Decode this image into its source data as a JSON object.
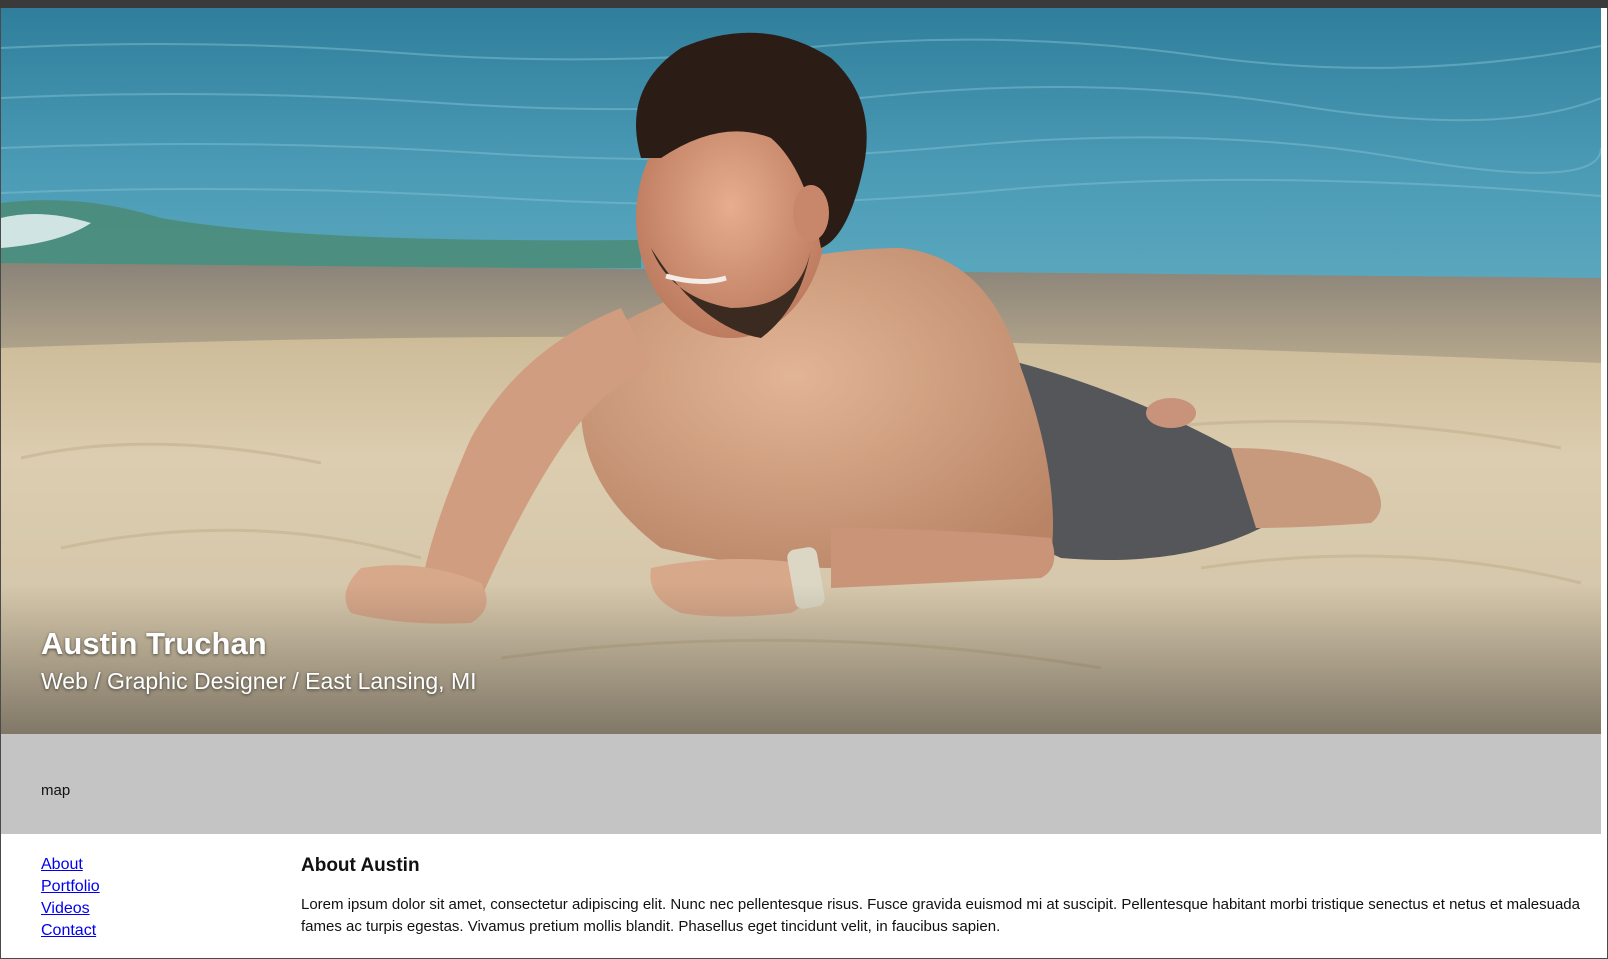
{
  "hero": {
    "name": "Austin Truchan",
    "tagline": "Web / Graphic Designer / East Lansing, MI",
    "image_alt": "beach-photo"
  },
  "map": {
    "label": "map",
    "background": "#c4c4c4"
  },
  "nav": {
    "items": [
      {
        "label": "About"
      },
      {
        "label": "Portfolio"
      },
      {
        "label": "Videos"
      },
      {
        "label": "Contact"
      }
    ],
    "link_color": "#0000ee"
  },
  "about": {
    "heading": "About Austin",
    "body": "Lorem ipsum dolor sit amet, consectetur adipiscing elit. Nunc nec pellentesque risus. Fusce gravida euismod mi at suscipit. Pellentesque habitant morbi tristique senectus et netus et malesuada fames ac turpis egestas. Vivamus pretium mollis blandit. Phasellus eget tincidunt velit, in faucibus sapien."
  }
}
